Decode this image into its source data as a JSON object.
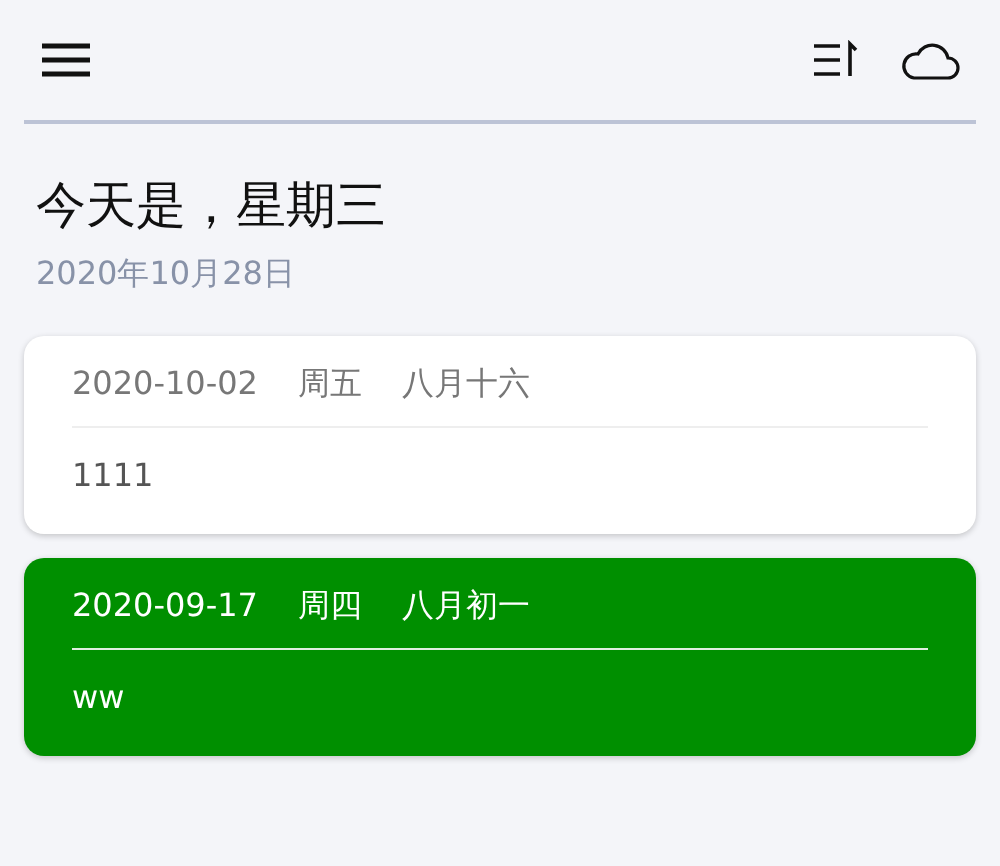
{
  "header": {
    "title": "今天是，星期三",
    "date": "2020年10月28日"
  },
  "entries": [
    {
      "date": "2020-10-02",
      "weekday": "周五",
      "lunar": "八月十六",
      "text": "1111",
      "color": "#ffffff"
    },
    {
      "date": "2020-09-17",
      "weekday": "周四",
      "lunar": "八月初一",
      "text": "ww",
      "color": "#008f00"
    }
  ]
}
